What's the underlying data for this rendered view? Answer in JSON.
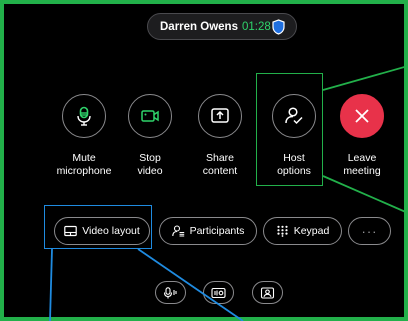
{
  "call": {
    "caller_name": "Darren Owens",
    "timer": "01:28",
    "secure_icon": "shield-icon"
  },
  "actions": [
    {
      "id": "mute",
      "label_line1": "Mute",
      "label_line2": "microphone",
      "icon": "microphone-icon"
    },
    {
      "id": "stop_video",
      "label_line1": "Stop",
      "label_line2": "video",
      "icon": "camera-icon"
    },
    {
      "id": "share",
      "label_line1": "Share",
      "label_line2": "content",
      "icon": "share-icon"
    },
    {
      "id": "host",
      "label_line1": "Host",
      "label_line2": "options",
      "icon": "host-options-icon"
    },
    {
      "id": "leave",
      "label_line1": "Leave",
      "label_line2": "meeting",
      "icon": "close-icon"
    }
  ],
  "secondary": {
    "video_layout": "Video layout",
    "participants": "Participants",
    "keypad": "Keypad",
    "more": "···"
  },
  "bottom_buttons": [
    "microphone-bars-icon",
    "recorder-icon",
    "person-frame-icon"
  ],
  "colors": {
    "background": "#000000",
    "frame_border": "#22b04a",
    "highlight_green": "#22b04a",
    "highlight_blue": "#1f8be0",
    "leave_red": "#e8324a",
    "timer_green": "#2fd46b",
    "button_outline": "#8a8a8d"
  }
}
